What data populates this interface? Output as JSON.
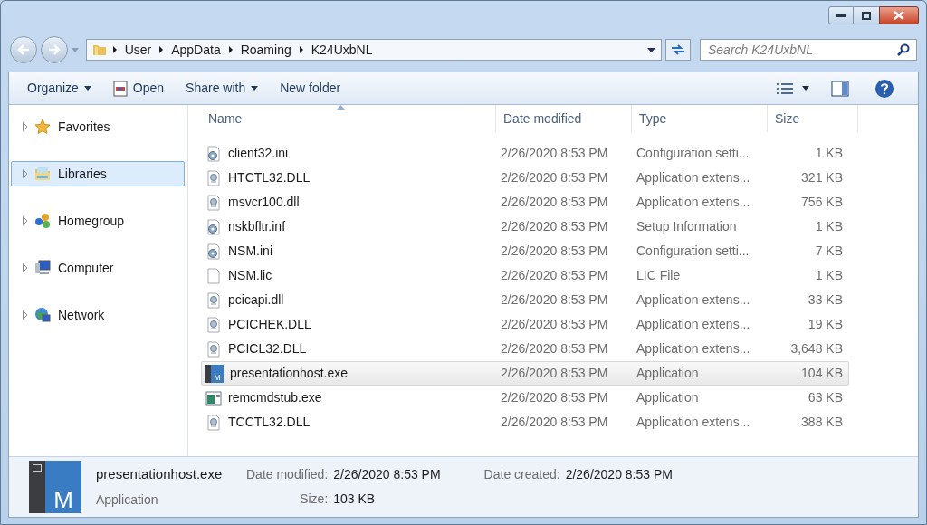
{
  "address": {
    "crumbs": [
      "User",
      "AppData",
      "Roaming",
      "K24UxbNL"
    ]
  },
  "search": {
    "placeholder": "Search K24UxbNL"
  },
  "toolbar": [
    {
      "label": "Organize",
      "kind": "menu"
    },
    {
      "label": "Open",
      "kind": "open"
    },
    {
      "label": "Share with",
      "kind": "menu"
    },
    {
      "label": "New folder",
      "kind": "plain"
    }
  ],
  "sidebar": {
    "items": [
      {
        "label": "Favorites",
        "kind": "star",
        "selected": false
      },
      {
        "label": "Libraries",
        "kind": "libraries",
        "selected": true
      },
      {
        "label": "Homegroup",
        "kind": "homegroup",
        "selected": false
      },
      {
        "label": "Computer",
        "kind": "computer",
        "selected": false
      },
      {
        "label": "Network",
        "kind": "network",
        "selected": false
      }
    ]
  },
  "table": {
    "columns": [
      "Name",
      "Date modified",
      "Type",
      "Size"
    ],
    "rows": [
      {
        "name": "client32.ini",
        "date": "2/26/2020 8:53 PM",
        "type": "Configuration setti...",
        "size": "1 KB",
        "kind": "config",
        "selected": false
      },
      {
        "name": "HTCTL32.DLL",
        "date": "2/26/2020 8:53 PM",
        "type": "Application extens...",
        "size": "321 KB",
        "kind": "dll",
        "selected": false
      },
      {
        "name": "msvcr100.dll",
        "date": "2/26/2020 8:53 PM",
        "type": "Application extens...",
        "size": "756 KB",
        "kind": "dll",
        "selected": false
      },
      {
        "name": "nskbfltr.inf",
        "date": "2/26/2020 8:53 PM",
        "type": "Setup Information",
        "size": "1 KB",
        "kind": "config",
        "selected": false
      },
      {
        "name": "NSM.ini",
        "date": "2/26/2020 8:53 PM",
        "type": "Configuration setti...",
        "size": "7 KB",
        "kind": "config",
        "selected": false
      },
      {
        "name": "NSM.lic",
        "date": "2/26/2020 8:53 PM",
        "type": "LIC File",
        "size": "1 KB",
        "kind": "blank",
        "selected": false
      },
      {
        "name": "pcicapi.dll",
        "date": "2/26/2020 8:53 PM",
        "type": "Application extens...",
        "size": "33 KB",
        "kind": "dll",
        "selected": false
      },
      {
        "name": "PCICHEK.DLL",
        "date": "2/26/2020 8:53 PM",
        "type": "Application extens...",
        "size": "19 KB",
        "kind": "dll",
        "selected": false
      },
      {
        "name": "PCICL32.DLL",
        "date": "2/26/2020 8:53 PM",
        "type": "Application extens...",
        "size": "3,648 KB",
        "kind": "dll",
        "selected": false
      },
      {
        "name": "presentationhost.exe",
        "date": "2/26/2020 8:53 PM",
        "type": "Application",
        "size": "104 KB",
        "kind": "app_logo",
        "icon_text": "M",
        "selected": true
      },
      {
        "name": "remcmdstub.exe",
        "date": "2/26/2020 8:53 PM",
        "type": "Application",
        "size": "63 KB",
        "kind": "app_window",
        "selected": false
      },
      {
        "name": "TCCTL32.DLL",
        "date": "2/26/2020 8:53 PM",
        "type": "Application extens...",
        "size": "388 KB",
        "kind": "dll",
        "selected": false
      }
    ]
  },
  "details": {
    "icon_text": "M",
    "name": "presentationhost.exe",
    "type": "Application",
    "fields": [
      {
        "label": "Date modified:",
        "value": "2/26/2020 8:53 PM"
      },
      {
        "label": "Date created:",
        "value": "2/26/2020 8:53 PM"
      },
      {
        "label": "Size:",
        "value": "103 KB"
      }
    ]
  }
}
